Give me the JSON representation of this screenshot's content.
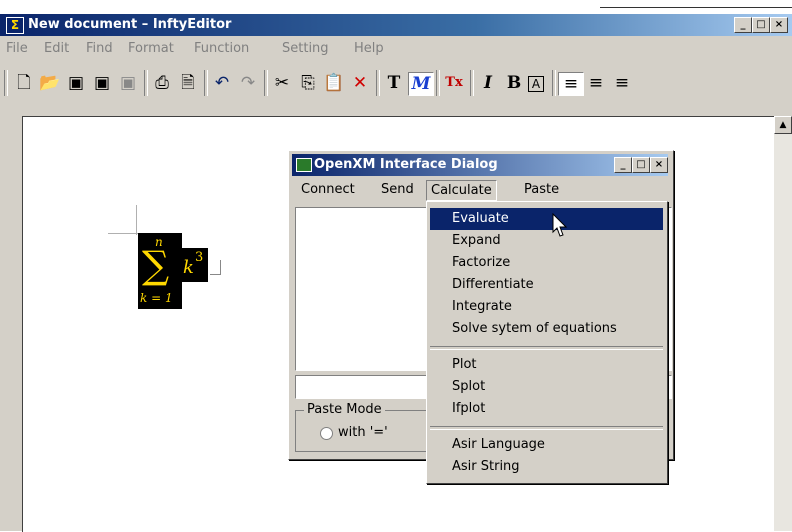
{
  "window": {
    "title": "New document  –  InftyEditor",
    "caption_buttons": [
      "_",
      "□",
      "×"
    ]
  },
  "menubar": [
    {
      "label": "File"
    },
    {
      "label": "Edit"
    },
    {
      "label": "Find"
    },
    {
      "label": "Format"
    },
    {
      "label": "Function"
    },
    {
      "label": "Setting"
    },
    {
      "label": "Help"
    }
  ],
  "toolbar_icons": [
    "new-document-icon",
    "open-folder-icon",
    "save-icon",
    "save-as-icon",
    "save-all-icon",
    "print-icon",
    "print-preview-icon",
    "undo-icon",
    "redo-icon",
    "cut-icon",
    "copy-icon",
    "paste-icon",
    "delete-icon",
    "text-mode-icon",
    "math-mode-icon",
    "tex-icon",
    "italic-icon",
    "bold-icon",
    "frame-icon",
    "align-left-icon",
    "align-center-icon",
    "align-right-icon"
  ],
  "toolbar_glyphs": {
    "text": "T",
    "math": "M",
    "tex": "Tx",
    "italic": "I",
    "bold": "B",
    "frame": "A"
  },
  "formula": {
    "upper": "n",
    "operator": "∑",
    "lower": "k = 1",
    "base": "k",
    "exponent": "3"
  },
  "dialog": {
    "title": "OpenXM Interface Dialog",
    "menus": [
      "Connect",
      "Send",
      "Calculate",
      "Paste"
    ],
    "active_menu": "Calculate",
    "paste_mode": {
      "legend": "Paste Mode",
      "option": "with '='"
    }
  },
  "dropdown": {
    "groups": [
      [
        "Evaluate",
        "Expand",
        "Factorize",
        "Differentiate",
        "Integrate",
        "Solve sytem of equations"
      ],
      [
        "Plot",
        "Splot",
        "Ifplot"
      ],
      [
        "Asir Language",
        "Asir String"
      ]
    ],
    "highlighted": "Evaluate"
  },
  "colors": {
    "title_bar": "#0a246a",
    "highlight": "#0a246a",
    "formula_bg": "#000000",
    "formula_fg": "#ffd800"
  }
}
